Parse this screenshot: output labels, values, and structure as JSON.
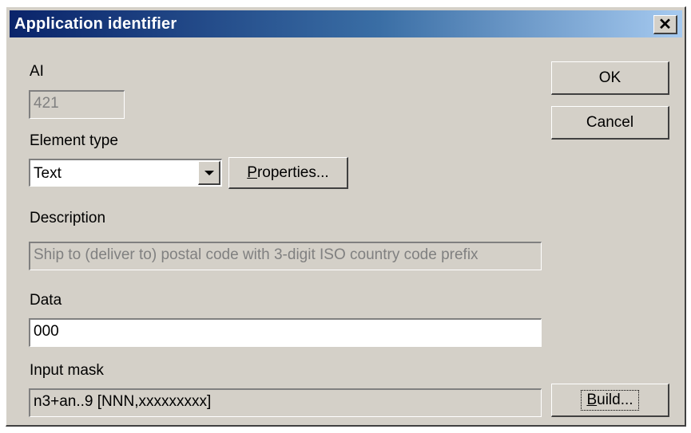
{
  "dialog": {
    "title": "Application identifier",
    "close_glyph": "✕"
  },
  "ai": {
    "label": "AI",
    "value": "421"
  },
  "element_type": {
    "label": "Element type",
    "value": "Text"
  },
  "properties_button": {
    "accel": "P",
    "rest": "roperties..."
  },
  "description": {
    "label": "Description",
    "value": "Ship to (deliver to) postal code with 3-digit ISO country code prefix"
  },
  "data_field": {
    "label": "Data",
    "value": "000"
  },
  "input_mask": {
    "label": "Input mask",
    "value": "n3+an..9 [NNN,xxxxxxxxx]"
  },
  "ok_button": {
    "label": "OK"
  },
  "cancel_button": {
    "label": "Cancel"
  },
  "build_button": {
    "accel": "B",
    "rest": "uild..."
  },
  "icons": {
    "close": "close-icon",
    "dropdown": "chevron-down-icon"
  }
}
